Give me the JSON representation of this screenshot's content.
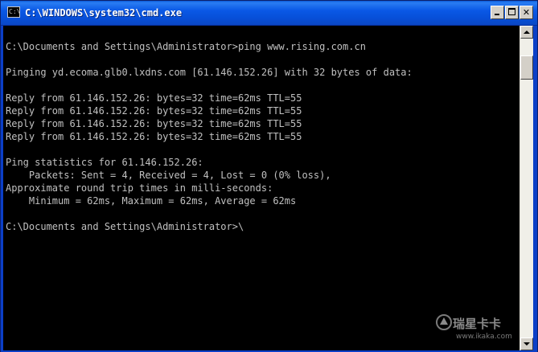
{
  "window": {
    "title": "C:\\WINDOWS\\system32\\cmd.exe",
    "icon": "cmd-icon",
    "icon_glyph": "C:\\",
    "controls": {
      "minimize": "minimize-icon",
      "maximize": "maximize-icon",
      "close_glyph": "✕"
    }
  },
  "console": {
    "background": "#000000",
    "foreground": "#c0c0c0",
    "lines": [
      "",
      "C:\\Documents and Settings\\Administrator>ping www.rising.com.cn",
      "",
      "Pinging yd.ecoma.glb0.lxdns.com [61.146.152.26] with 32 bytes of data:",
      "",
      "Reply from 61.146.152.26: bytes=32 time=62ms TTL=55",
      "Reply from 61.146.152.26: bytes=32 time=62ms TTL=55",
      "Reply from 61.146.152.26: bytes=32 time=62ms TTL=55",
      "Reply from 61.146.152.26: bytes=32 time=62ms TTL=55",
      "",
      "Ping statistics for 61.146.152.26:",
      "    Packets: Sent = 4, Received = 4, Lost = 0 (0% loss),",
      "Approximate round trip times in milli-seconds:",
      "    Minimum = 62ms, Maximum = 62ms, Average = 62ms",
      "",
      "C:\\Documents and Settings\\Administrator>\\"
    ]
  },
  "scrollbar": {
    "up_icon": "scroll-up-arrow-icon",
    "down_icon": "scroll-down-arrow-icon",
    "position_fraction": 0.0
  },
  "watermark": {
    "brand_cn": "瑞星卡卡",
    "url": "www.ikaka.com"
  }
}
